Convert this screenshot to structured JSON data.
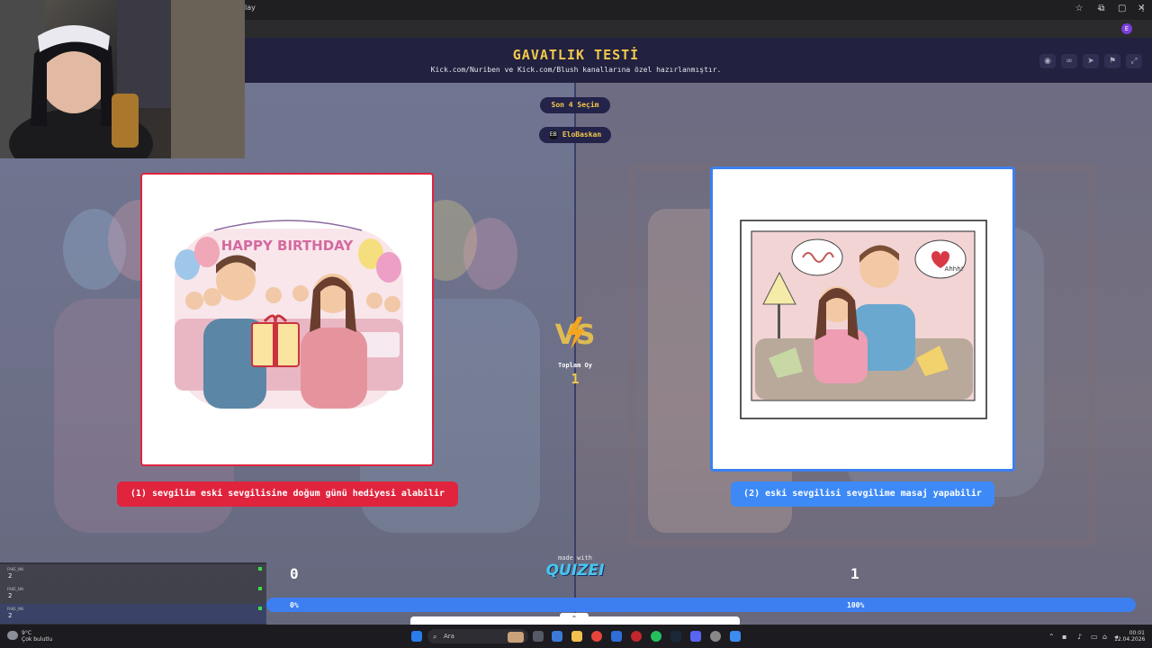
{
  "browser": {
    "tab_fragment": "lay",
    "window_controls": [
      "–",
      "▢",
      "✕"
    ],
    "profile_initial": "E"
  },
  "header": {
    "title": "GAVATLIK TESTİ",
    "subtitle": "Kick.com/Nuriben ve Kick.com/Blush kanallarına özel hazırlanmıştır.",
    "actions": [
      "eye-icon",
      "link-icon",
      "send-icon",
      "flag-icon",
      "expand-icon"
    ]
  },
  "round": {
    "stage_label": "Son 4 Seçim",
    "user_label": "EloBaskan",
    "user_avatar": "EB"
  },
  "options": [
    {
      "label": "(1) sevgilim eski sevgilisine doğum günü hediyesi alabilir",
      "votes": "0",
      "percent": "0%",
      "color": "#e0243e"
    },
    {
      "label": "(2) eski sevgilisi sevgilime masaj yapabilir",
      "votes": "1",
      "percent": "100%",
      "color": "#3d8af7"
    }
  ],
  "images": {
    "left_banner": "HAPPY BIRTHDAY",
    "right_bubble": "Ahhh!"
  },
  "vs": {
    "label": "VS",
    "total_label": "Toplam Oy",
    "total_value": "1"
  },
  "branding": {
    "made_with": "made with",
    "logo": "QUIZEI"
  },
  "progress": {
    "left_fraction": 0.0
  },
  "chat": [
    {
      "name": "FAKE_NN",
      "message": "2"
    },
    {
      "name": "FAKE_NN",
      "message": "2"
    },
    {
      "name": "FAKE_NN",
      "message": "2"
    }
  ],
  "taskbar": {
    "weather_temp": "9°C",
    "weather_text": "Çok bulutlu",
    "search_placeholder": "Ara",
    "time": "00:01",
    "date": "12.04.2026"
  }
}
